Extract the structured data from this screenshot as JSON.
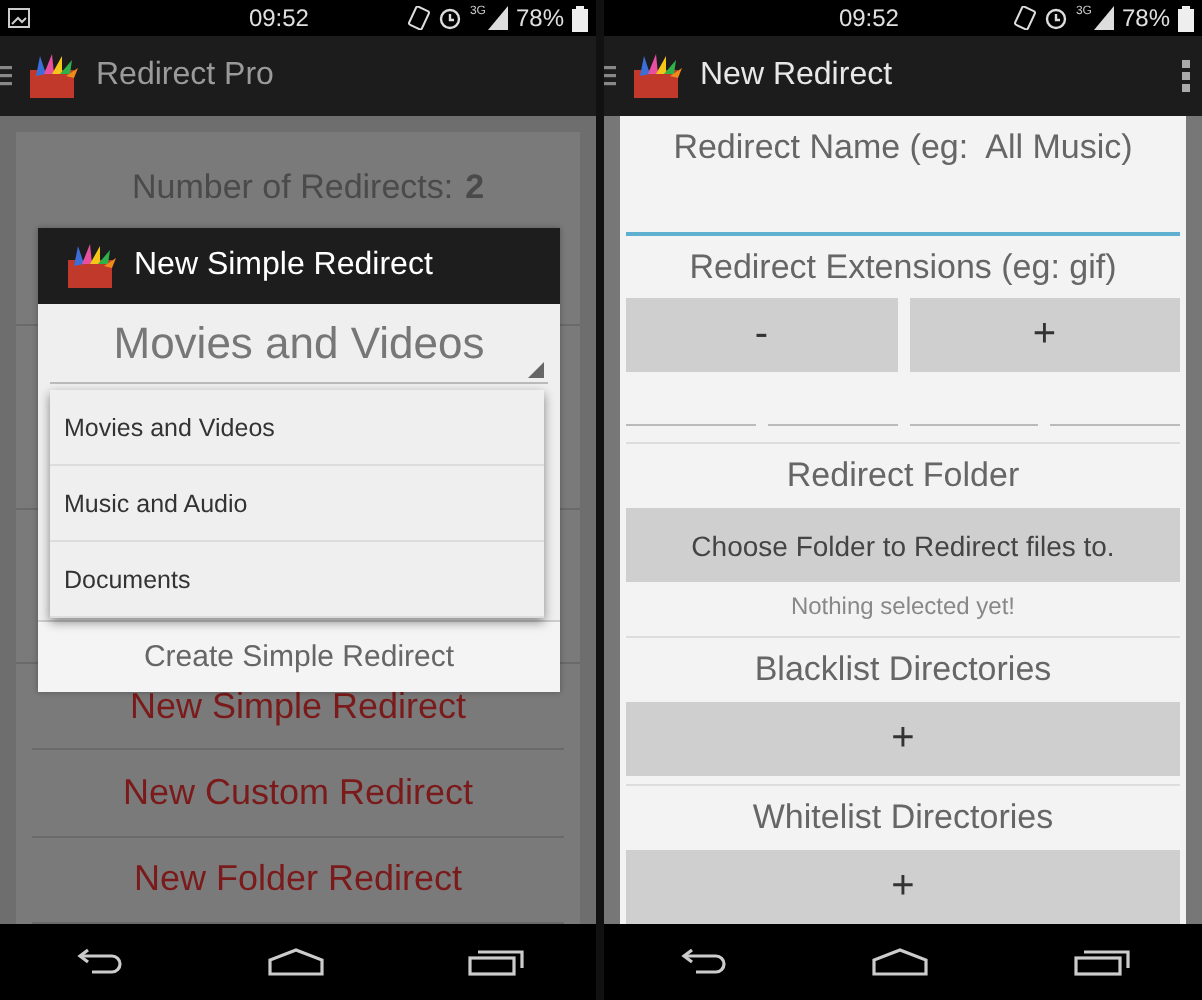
{
  "main_screen": {
    "status_bar": {
      "notification": true,
      "time": "09:52",
      "network": "3G",
      "battery": "78%"
    },
    "app_bar": {
      "title": "Redirect Pro"
    },
    "summary": {
      "label": "Number of Redirects:",
      "count": "2"
    },
    "actions": [
      "New Simple Redirect",
      "New Custom Redirect",
      "New Folder Redirect"
    ],
    "dialog": {
      "title": "New Simple Redirect",
      "spinner": {
        "value": "Movies and Videos"
      },
      "dropdown": [
        "Movies and Videos",
        "Music and Audio",
        "Documents"
      ],
      "confirm_button": "Create Simple Redirect"
    }
  },
  "new_redirect_screen": {
    "status_bar": {
      "notification": false,
      "time": "09:52",
      "network": "3G",
      "battery": "78%"
    },
    "app_bar": {
      "title": "New Redirect"
    },
    "name": {
      "label": "Redirect Name (eg:  All Music)",
      "focused": true
    },
    "extensions": {
      "label": "Redirect Extensions (eg: gif)",
      "remove_button": "-",
      "add_button": "+"
    },
    "folder": {
      "label": "Redirect Folder",
      "choose_button": "Choose Folder to Redirect files to.",
      "status": "Nothing selected yet!"
    },
    "blacklist": {
      "label": "Blacklist Directories",
      "add_button": "+"
    },
    "whitelist": {
      "label": "Whitelist Directories",
      "add_button": "+"
    }
  }
}
